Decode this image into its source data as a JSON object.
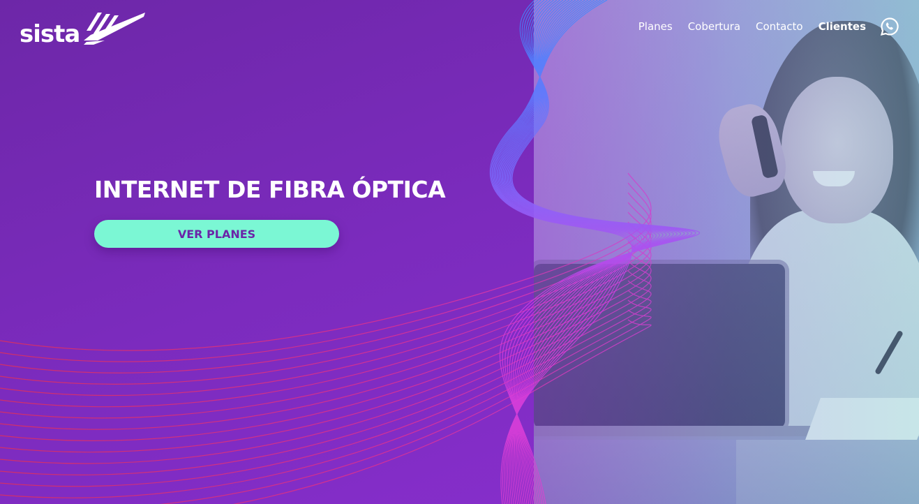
{
  "brand": {
    "name": "sista",
    "accent": "#7bf7d4",
    "primary": "#7b2bbd"
  },
  "nav": {
    "items": [
      {
        "label": "Planes"
      },
      {
        "label": "Cobertura"
      },
      {
        "label": "Contacto"
      },
      {
        "label": "Clientes"
      }
    ],
    "whatsapp_icon": "whatsapp-icon"
  },
  "hero": {
    "headline": "INTERNET DE FIBRA ÓPTICA",
    "cta_label": "VER PLANES",
    "image": "woman-on-phone-with-laptop"
  }
}
